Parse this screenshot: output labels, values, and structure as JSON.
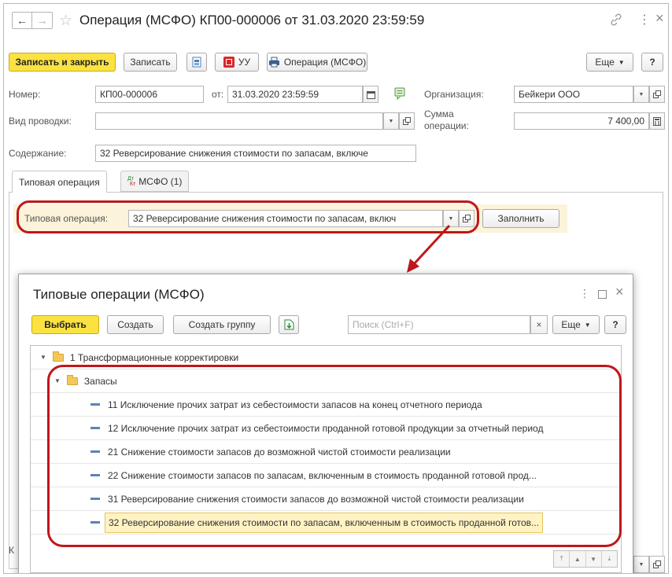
{
  "window": {
    "title": "Операция (МСФО) КП00-000006 от 31.03.2020 23:59:59"
  },
  "toolbar": {
    "save_close": "Записать и закрыть",
    "save": "Записать",
    "uu": "УУ",
    "operation": "Операция (МСФО)",
    "more": "Еще",
    "help": "?"
  },
  "form": {
    "number_label": "Номер:",
    "number_value": "КП00-000006",
    "date_label": "от:",
    "date_value": "31.03.2020 23:59:59",
    "org_label": "Организация:",
    "org_value": "Бейкери ООО",
    "posting_kind_label": "Вид проводки:",
    "posting_kind_value": "",
    "sum_label_1": "Сумма",
    "sum_label_2": "операции:",
    "sum_value": "7 400,00",
    "content_label": "Содержание:",
    "content_value": "32 Реверсирование снижения стоимости по запасам, включе"
  },
  "tabs": [
    {
      "label": "Типовая операция"
    },
    {
      "label": "МСФО (1)",
      "icon_top": "Дт",
      "icon_bottom": "Кт"
    }
  ],
  "typical": {
    "label": "Типовая операция:",
    "value": "32 Реверсирование снижения стоимости по запасам, включ",
    "fill": "Заполнить"
  },
  "dialog": {
    "title": "Типовые операции (МСФО)",
    "select": "Выбрать",
    "create": "Создать",
    "create_group": "Создать группу",
    "search_placeholder": "Поиск (Ctrl+F)",
    "more": "Еще",
    "help": "?",
    "tree": [
      {
        "text": "1 Трансформационные корректировки",
        "kind": "folder",
        "level": 0
      },
      {
        "text": "Запасы",
        "kind": "folder",
        "level": 1
      },
      {
        "text": "11 Исключение прочих затрат из себестоимости запасов на конец отчетного периода",
        "kind": "item",
        "level": 2
      },
      {
        "text": "12 Исключение прочих затрат из себестоимости проданной готовой продукции за отчетный период",
        "kind": "item",
        "level": 2
      },
      {
        "text": "21 Снижение стоимости запасов до возможной чистой стоимости реализации",
        "kind": "item",
        "level": 2
      },
      {
        "text": "22 Снижение стоимости запасов по запасам, включенным в стоимость проданной готовой прод...",
        "kind": "item",
        "level": 2
      },
      {
        "text": "31 Реверсирование снижения стоимости запасов до возможной чистой стоимости реализации",
        "kind": "item",
        "level": 2
      },
      {
        "text": "32 Реверсирование снижения стоимости по запасам, включенным в стоимость проданной готов...",
        "kind": "item",
        "level": 2,
        "selected": true
      }
    ]
  },
  "colors": {
    "primary_button": "#fbe241",
    "highlight_red": "#c0161b",
    "selected_row": "#fff3c4",
    "tree_dash": "#5a84b8",
    "folder": "#f3c85b"
  },
  "icons": {
    "back": "←",
    "forward": "→",
    "star": "☆",
    "link": "🔗",
    "menu": "⋮",
    "close": "×"
  }
}
